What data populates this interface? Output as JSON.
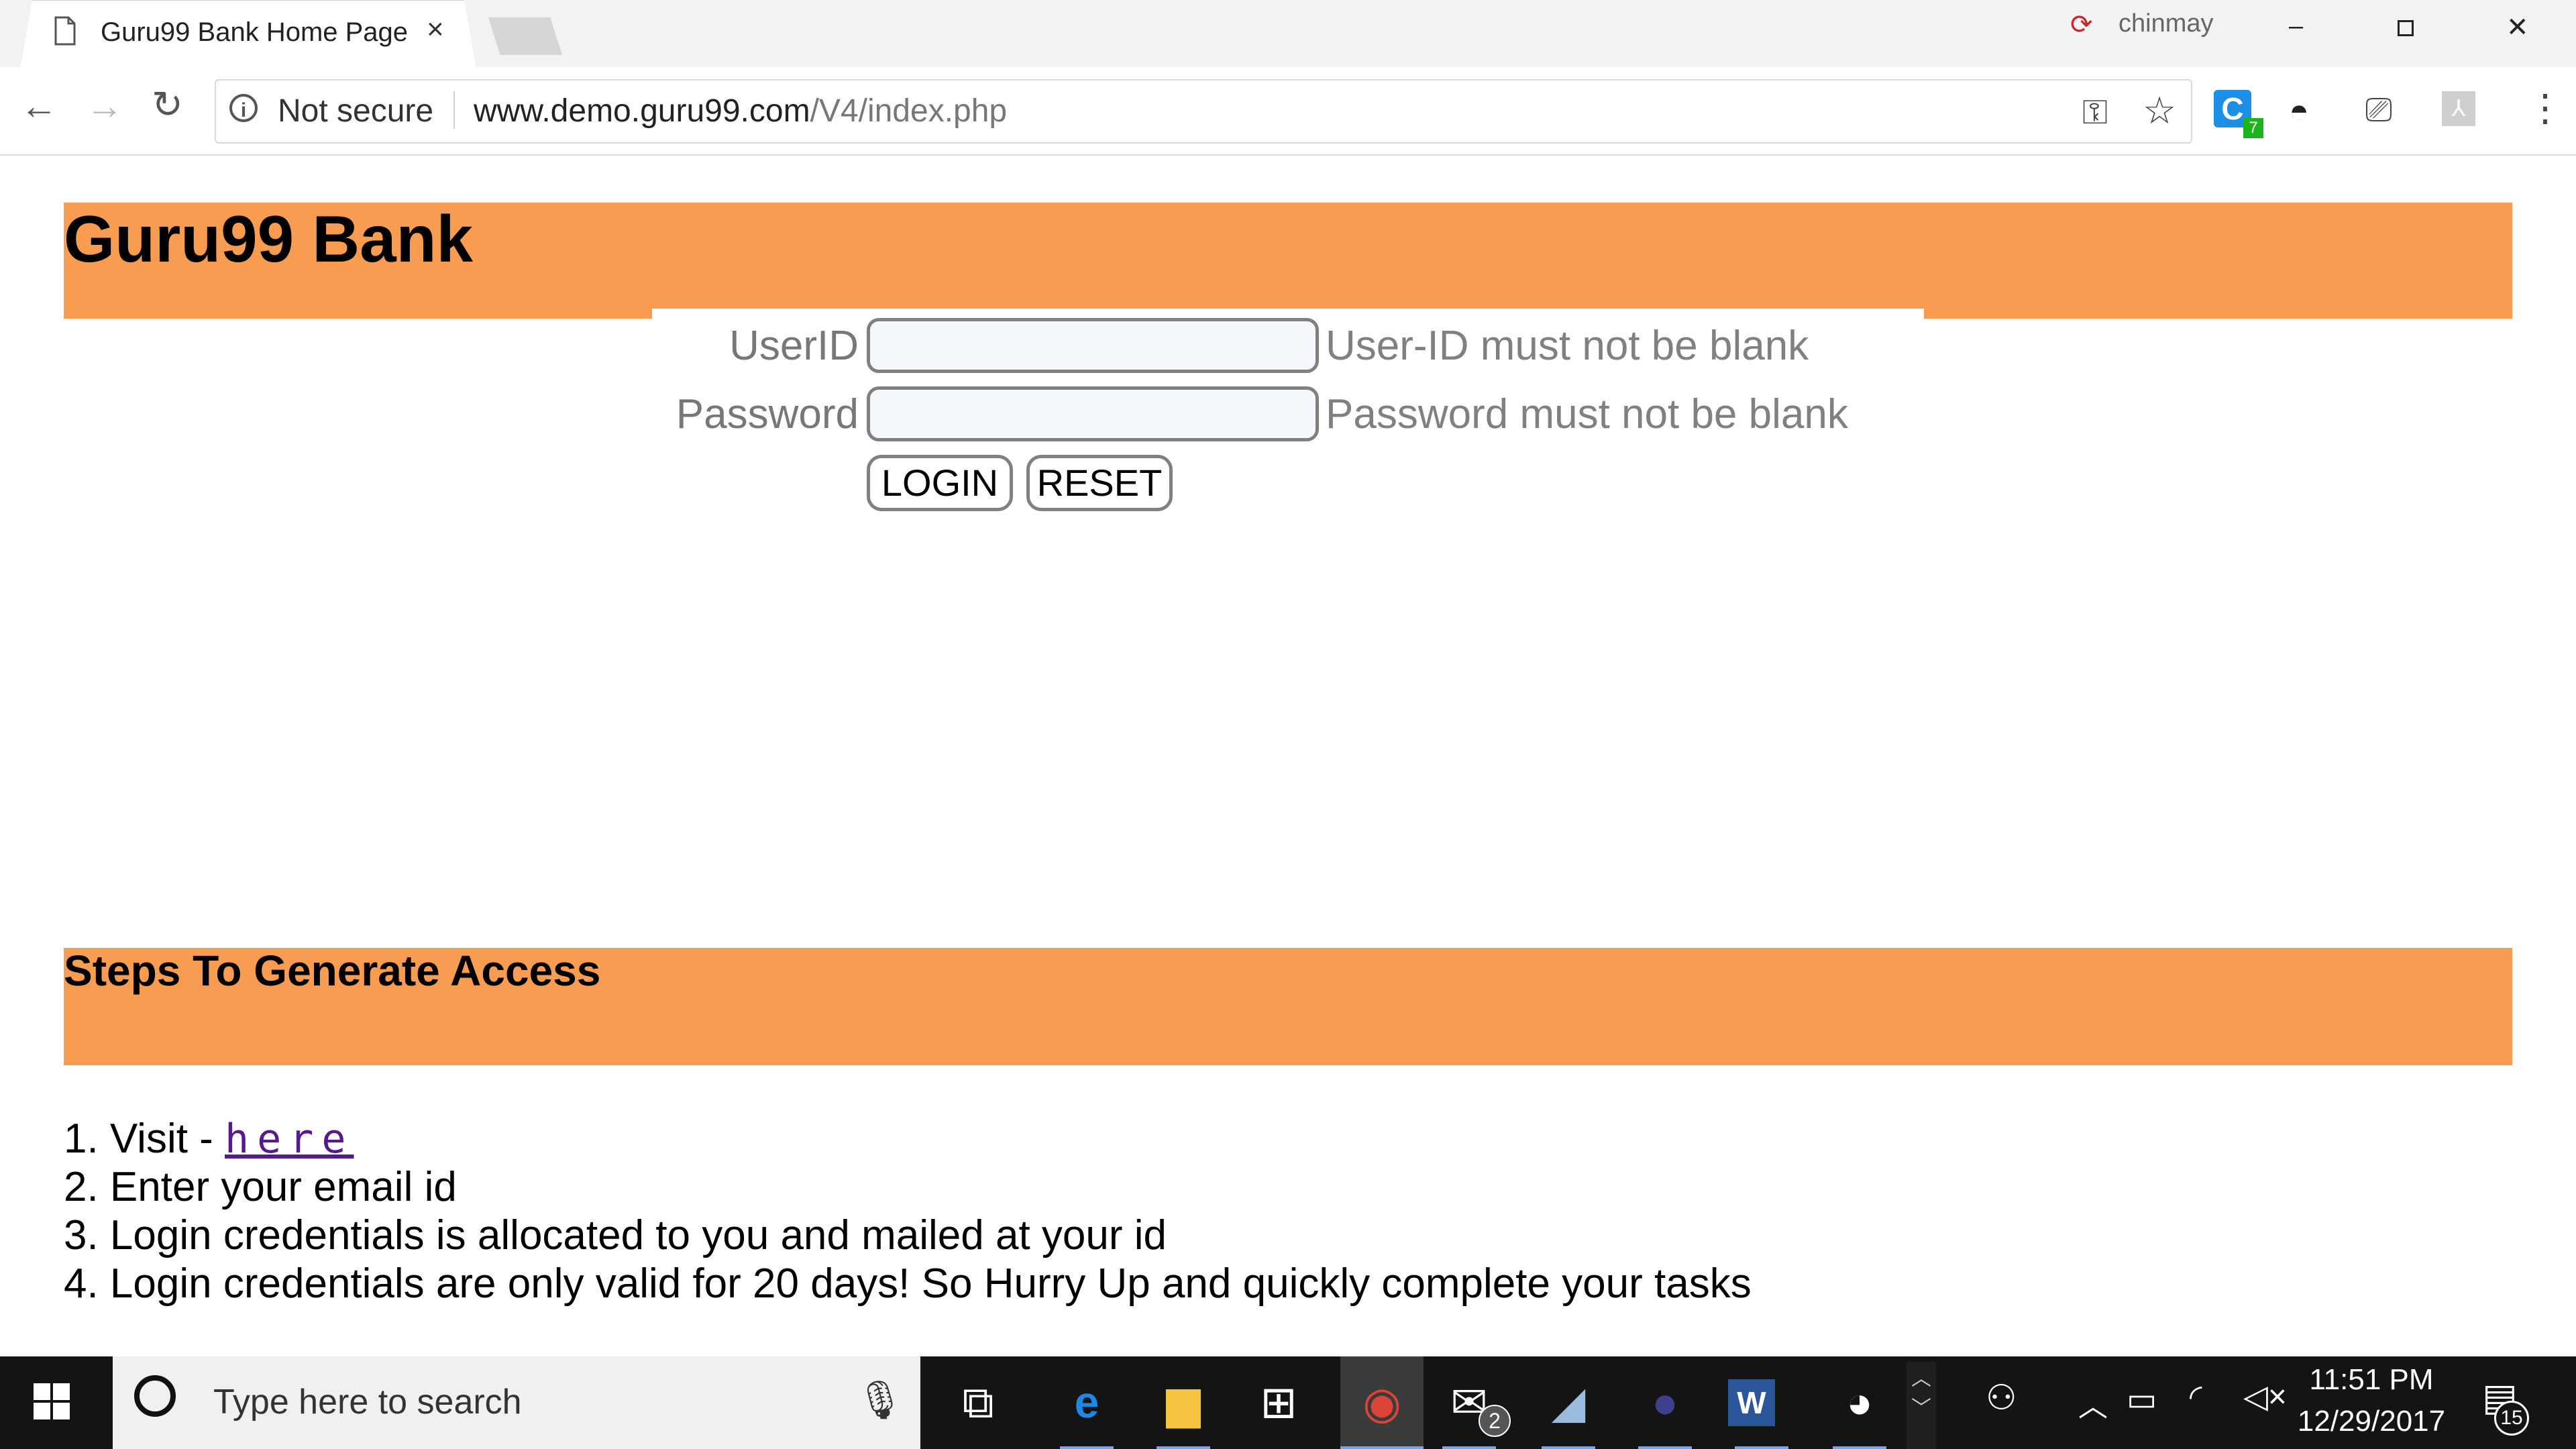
{
  "browser": {
    "tab_title": "Guru99 Bank Home Page",
    "tab_close": "×",
    "profile_name": "chinmay",
    "security_label": "Not secure",
    "url_host": "www.demo.guru99.com",
    "url_path": "/V4/index.php",
    "extension_badge": "7"
  },
  "page": {
    "title": "Guru99 Bank",
    "form": {
      "userid_label": "UserID",
      "password_label": "Password",
      "userid_value": "",
      "password_value": "",
      "userid_error": "User-ID must not be blank",
      "password_error": "Password must not be blank",
      "login_label": "LOGIN",
      "reset_label": "RESET"
    },
    "steps": {
      "title": "Steps To Generate Access",
      "step1_prefix": "1. Visit - ",
      "step1_link": "here",
      "step2": "2. Enter your email id",
      "step3": "3. Login credentials is allocated to you and mailed at your id",
      "step4": "4. Login credentials are only valid for 20 days! So Hurry Up and quickly complete your tasks"
    },
    "colors": {
      "banner": "#f79c50",
      "link": "#551a8b",
      "label_gray": "#777777"
    }
  },
  "taskbar": {
    "search_placeholder": "Type here to search",
    "mail_badge": "2",
    "clock_time": "11:51 PM",
    "clock_date": "12/29/2017",
    "notification_count": "15"
  }
}
